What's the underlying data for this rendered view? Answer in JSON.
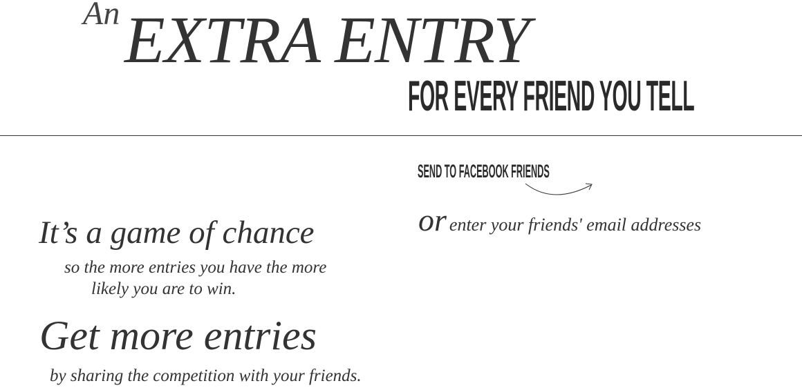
{
  "header": {
    "an": "An",
    "extra_entry": "EXTRA ENTRY",
    "for_every_friend": "FOR EVERY FRIEND YOU TELL"
  },
  "share": {
    "facebook_label": "SEND TO FACEBOOK FRIENDS",
    "or": "or",
    "email_prompt": "enter your friends' email addresses"
  },
  "info": {
    "chance_heading": "It’s a game of chance",
    "chance_line1": "so the more entries you have the more",
    "chance_line2": "likely you are to win.",
    "entries_heading": "Get more entries",
    "entries_sub": "by sharing the competition with your friends."
  }
}
